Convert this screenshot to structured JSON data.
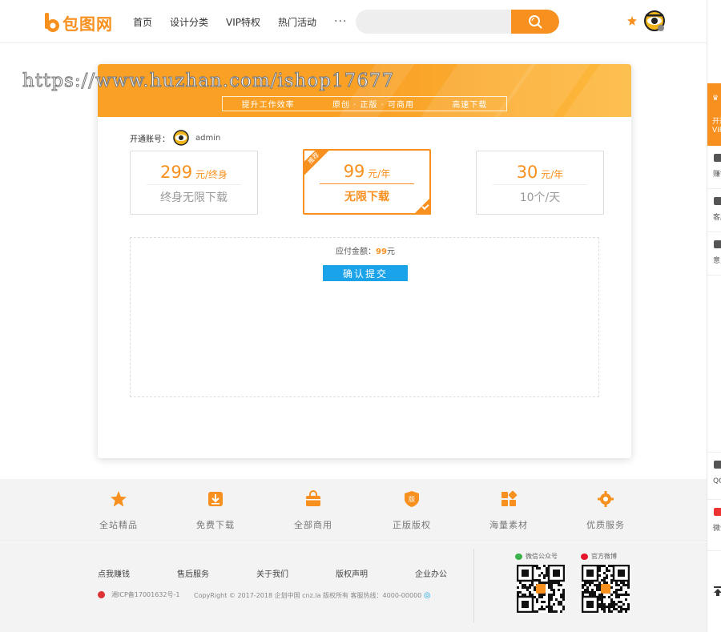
{
  "header": {
    "logo_text": "包图网",
    "nav": [
      "首页",
      "设计分类",
      "VIP特权",
      "热门活动"
    ],
    "more": "···",
    "search_placeholder": ""
  },
  "banner": {
    "title": "",
    "slogans": [
      "提升工作效率",
      "原创 · 正版 · 可商用",
      "高速下载"
    ]
  },
  "account": {
    "label": "开通账号：",
    "username": "admin"
  },
  "plans": [
    {
      "price": "299",
      "unit": "元/终身",
      "desc": "终身无限下载",
      "recommended": false
    },
    {
      "price": "99",
      "unit": "元/年",
      "desc": "无限下载",
      "recommended": true,
      "badge": "推荐"
    },
    {
      "price": "30",
      "unit": "元/年",
      "desc": "10个/天",
      "recommended": false
    }
  ],
  "payment": {
    "label": "应付金额：",
    "amount": "99",
    "currency": "元",
    "confirm": "确认提交"
  },
  "watermark": "https://www.huzhan.com/ishop17677",
  "features": [
    {
      "label": "全站精品",
      "icon": "star-icon"
    },
    {
      "label": "免费下载",
      "icon": "download-icon"
    },
    {
      "label": "全部商用",
      "icon": "bag-icon"
    },
    {
      "label": "正版版权",
      "icon": "shield-icon"
    },
    {
      "label": "海量素材",
      "icon": "grid-icon"
    },
    {
      "label": "优质服务",
      "icon": "gear-icon"
    }
  ],
  "footer": {
    "links": [
      "点我赚钱",
      "售后服务",
      "关于我们",
      "版权声明",
      "企业办公"
    ],
    "icp": "湘ICP备17001632号-1",
    "copyright": "CopyRight © 2017-2018 企划中国 cnz.la 版权所有 客服热线：4000-00000",
    "wechat": "微信公众号",
    "weibo": "官方微博"
  },
  "rail": {
    "vip": [
      "开通",
      "VIP"
    ],
    "items": [
      "赚钱",
      "客服",
      "意见",
      "QQ群联系",
      "微信礼包"
    ]
  },
  "colors": {
    "accent": "#f7901e",
    "button": "#1aa3e8"
  }
}
